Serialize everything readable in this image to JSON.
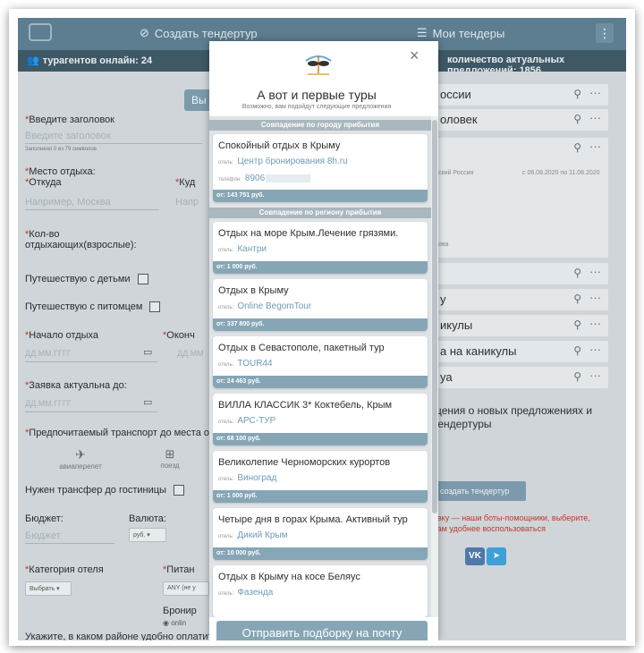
{
  "app": {
    "create_tender": "Создать тендертур",
    "my_tenders": "Мои тендеры",
    "agents_online": "турагентов онлайн: 24",
    "offers_count": "количество актуальных предложений: 1856"
  },
  "form": {
    "search_btn": "Вы",
    "title_label": "Введите заголовок",
    "title_placeholder": "Введите заголовок",
    "title_counter": "Заполнено 0 из 79 символов",
    "place_label": "Место отдыха:",
    "from_label": "Откуда",
    "to_label": "Куд",
    "from_placeholder": "Например, Москва",
    "to_placeholder": "Напр",
    "count_label": "Кол-во отдыхающих(взрослые):",
    "kids_label": "Путешествую с детьми",
    "pet_label": "Путешествую с питомцем",
    "start_label": "Начало отдыха",
    "end_label": "Оконч",
    "date_placeholder": "ДД.ММ.ГГГГ",
    "date_placeholder_short": "ДД.ММ",
    "valid_label": "Заявка актуальна до:",
    "transport_label": "Предпочитаемый транспорт до места о",
    "plane": "авиаперелет",
    "train": "поезд",
    "transfer_label": "Нужен трансфер до гостиницы",
    "budget_label": "Бюджет:",
    "budget_placeholder": "Бюджет",
    "currency_label": "Валюта:",
    "currency_value": "руб.",
    "hotel_cat_label": "Категория отеля",
    "hotel_cat_value": "Выбрать",
    "food_label": "Питан",
    "food_value": "ANY (не у",
    "booking_label": "Бронир",
    "online_label": "onlin",
    "district_label": "Укажите, в каком районе удобно оплатит"
  },
  "right": {
    "rows": [
      "оссии",
      "оловек",
      "",
      "",
      "у",
      "икулы",
      "а на каникулы",
      "уа"
    ],
    "card_place": "ский Россия",
    "card_dates": "с 06.08.2020 по 11.08.2020",
    "card_extra": "ова",
    "notif": "щения о новых предложениях и тендертуры",
    "create_btn": "создать тендертур",
    "note": "явку — наши боты-помощники, выберите, вам удобнее воспользоваться",
    "vk": "VK",
    "tg": "➤"
  },
  "modal": {
    "close": "×",
    "title": "А вот и первые туры",
    "subtitle": "Возможно, вам подойдут следующие предложения",
    "sec_city": "Совпадение по городу прибытия",
    "sec_region": "Совпадение по региону прибытия",
    "hotel_label": "отель:",
    "phone_label": "телефон:",
    "first": {
      "name": "Спокойный отдых в Крыму",
      "hotel": "Центр бронирования 8h.ru",
      "phone": "8906",
      "price": "от: 143 751 руб."
    },
    "tours": [
      {
        "name": "Отдых на море Крым.Лечение грязями.",
        "hotel": "Кантри",
        "price": "от: 1 000 руб."
      },
      {
        "name": "Отдых в Крыму",
        "hotel": "Online BegomTour",
        "price": "от: 337 800 руб."
      },
      {
        "name": "Отдых в Севастополе, пакетный тур",
        "hotel": "TOUR44",
        "price": "от: 24 463 руб."
      },
      {
        "name": "ВИЛЛА КЛАССИК 3* Коктебель, Крым",
        "hotel": "АРС-ТУР",
        "price": "от: 68 100 руб."
      },
      {
        "name": "Великолепие Черноморских курортов",
        "hotel": "Виноград",
        "price": "от: 1 000 руб."
      },
      {
        "name": "Четыре дня в горах Крыма. Активный тур",
        "hotel": "Дикий Крым",
        "price": "от: 10 000 руб."
      },
      {
        "name": "Отдых в Крыму на косе Беляус",
        "hotel": "Фазенда",
        "price": ""
      }
    ],
    "send_btn": "Отправить подборку на почту"
  },
  "colors": {
    "topbar": "#5d7e90",
    "accent": "#86a6b6",
    "section": "#aab7bf",
    "link": "#6f9bb5"
  },
  "icons": [
    "logo-icon",
    "create-icon",
    "list-icon",
    "menu-icon",
    "users-icon",
    "search-icon",
    "more-icon",
    "close-icon",
    "sunglasses-icon",
    "plane-icon",
    "train-icon",
    "calendar-icon",
    "vk-icon",
    "telegram-icon"
  ]
}
